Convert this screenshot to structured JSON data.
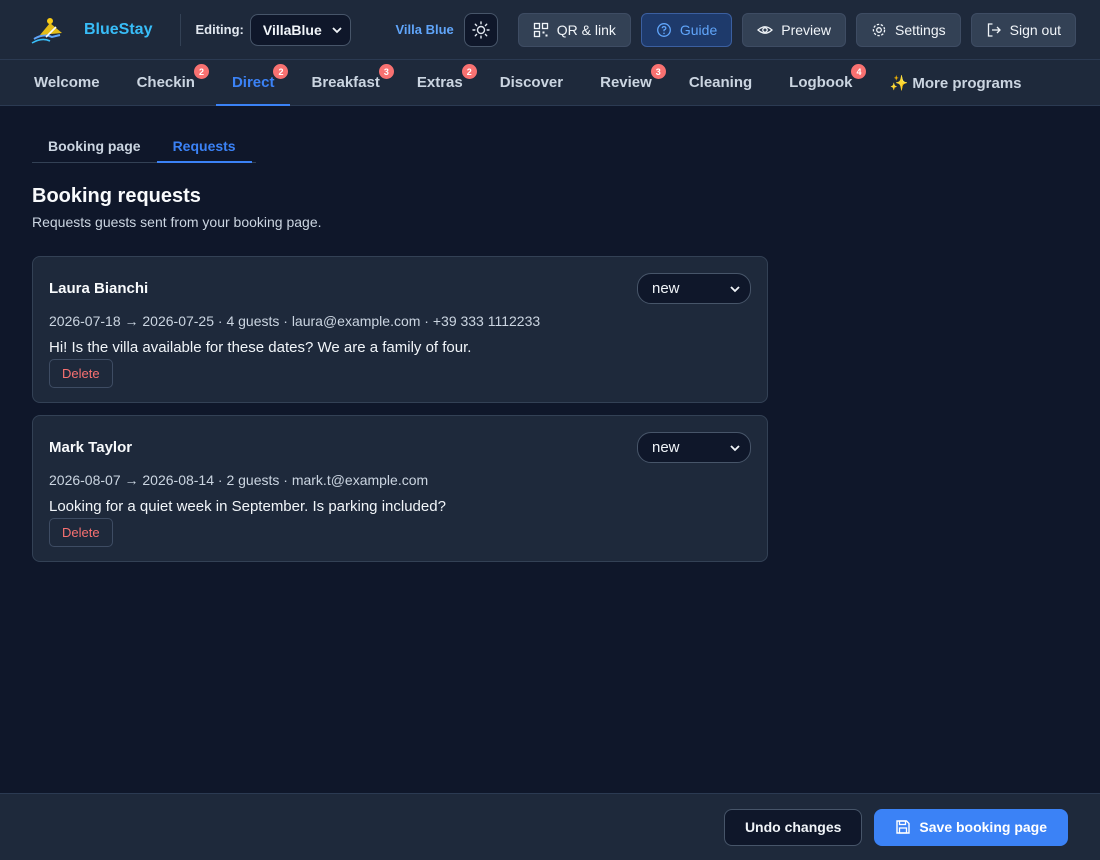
{
  "app": {
    "brand_name": "BlueStay",
    "editing_label": "Editing:",
    "villa_selected": "VillaBlue",
    "villa_name": "Villa Blue"
  },
  "header": {
    "buttons": {
      "qr": "QR & link",
      "guide": "Guide",
      "preview": "Preview",
      "settings": "Settings",
      "signout": "Sign out"
    }
  },
  "tabs": [
    {
      "label": "Welcome",
      "badge": ""
    },
    {
      "label": "Checkin",
      "badge": "2"
    },
    {
      "label": "Direct",
      "badge": "2"
    },
    {
      "label": "Breakfast",
      "badge": "3"
    },
    {
      "label": "Extras",
      "badge": "2"
    },
    {
      "label": "Discover",
      "badge": ""
    },
    {
      "label": "Review",
      "badge": "3"
    },
    {
      "label": "Cleaning",
      "badge": ""
    },
    {
      "label": "Logbook",
      "badge": "4"
    },
    {
      "label": "✨ More programs",
      "badge": ""
    }
  ],
  "active_tab": "Direct",
  "subtabs": {
    "booking_page": "Booking page",
    "requests": "Requests"
  },
  "section": {
    "title": "Booking requests",
    "subtitle": "Requests guests sent from your booking page."
  },
  "requests": [
    {
      "name": "Laura Bianchi",
      "status": "new",
      "details": "2026-07-18 → 2026-07-25 · 4 guests · laura@example.com · +39 333 1112233",
      "message": "Hi! Is the villa available for these dates? We are a family of four.",
      "delete_label": "Delete"
    },
    {
      "name": "Mark Taylor",
      "status": "new",
      "details": "2026-08-07 → 2026-08-14 · 2 guests · mark.t@example.com",
      "message": "Looking for a quiet week in September. Is parking included?",
      "delete_label": "Delete"
    }
  ],
  "footer": {
    "undo": "Undo changes",
    "save": "Save booking page"
  },
  "colors": {
    "accent": "#3b82f6",
    "badge": "#f87171",
    "background": "#0f172a",
    "panel": "#1e293b"
  }
}
